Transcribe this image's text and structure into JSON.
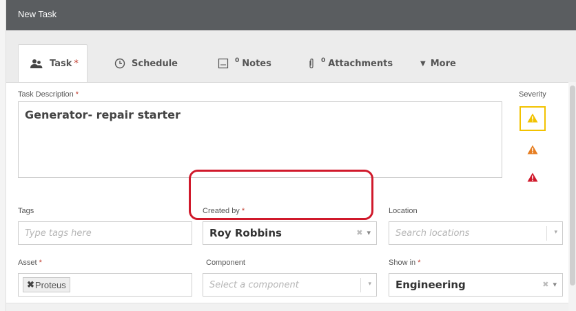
{
  "window": {
    "title": "New Task"
  },
  "tabs": [
    {
      "label": "Task",
      "required_mark": "*",
      "icon": "users-icon",
      "active": true
    },
    {
      "label": "Schedule",
      "icon": "clock-icon"
    },
    {
      "label": "Notes",
      "count": "0",
      "icon": "note-icon"
    },
    {
      "label": "Attachments",
      "count": "0",
      "icon": "paperclip-icon"
    },
    {
      "label": "More",
      "prefix": "▼",
      "icon": "caret-down-icon"
    }
  ],
  "form": {
    "description": {
      "label": "Task Description",
      "required_mark": "*",
      "value": "Generator- repair starter"
    },
    "severity": {
      "label": "Severity",
      "levels": [
        {
          "name": "low",
          "color": "#f2c200",
          "selected": true
        },
        {
          "name": "medium",
          "color": "#e67e22"
        },
        {
          "name": "high",
          "color": "#d0192b"
        }
      ]
    },
    "tags": {
      "label": "Tags",
      "placeholder": "Type tags here"
    },
    "created_by": {
      "label": "Created by",
      "required_mark": "*",
      "value": "Roy Robbins",
      "clear": "✖",
      "caret": "▾"
    },
    "location": {
      "label": "Location",
      "placeholder": "Search locations",
      "caret": "▾"
    },
    "asset": {
      "label": "Asset",
      "required_mark": "*",
      "chip": "Proteus",
      "chip_remove": "✖"
    },
    "component": {
      "label": "Component",
      "placeholder": "Select a component",
      "caret": "▾"
    },
    "show_in": {
      "label": "Show in",
      "required_mark": "*",
      "value": "Engineering",
      "clear": "✖",
      "caret": "▾"
    }
  },
  "colors": {
    "titlebar": "#5a5d60",
    "required": "#c0392b",
    "highlight": "#d0192b",
    "tab_strip": "#ececec"
  }
}
